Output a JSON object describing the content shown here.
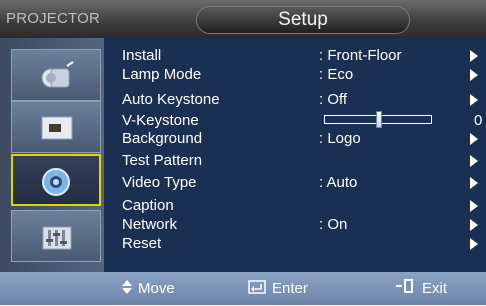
{
  "header": {
    "brand": "PROJECTOR",
    "title": "Setup"
  },
  "sidebar": {
    "items": [
      {
        "name": "picture",
        "icon": "projector-lens-icon",
        "active": false
      },
      {
        "name": "screen",
        "icon": "display-screen-icon",
        "active": false
      },
      {
        "name": "setup",
        "icon": "gear-icon",
        "active": true
      },
      {
        "name": "sound",
        "icon": "equalizer-icon",
        "active": false
      }
    ]
  },
  "menu": {
    "items": [
      {
        "label": "Install",
        "value": ": Front-Floor",
        "has_arrow": true
      },
      {
        "label": "Lamp Mode",
        "value": ": Eco",
        "has_arrow": true
      },
      {
        "label": "Auto Keystone",
        "value": ": Off",
        "has_arrow": true
      },
      {
        "label": "V-Keystone",
        "value": "",
        "has_arrow": false,
        "slider_value": "0",
        "slider_fraction": 0.5
      },
      {
        "label": "Background",
        "value": ": Logo",
        "has_arrow": true
      },
      {
        "label": "Test Pattern",
        "value": "",
        "has_arrow": true
      },
      {
        "label": "Video Type",
        "value": ": Auto",
        "has_arrow": true
      },
      {
        "label": "Caption",
        "value": "",
        "has_arrow": true
      },
      {
        "label": "Network",
        "value": ": On",
        "has_arrow": true
      },
      {
        "label": "Reset",
        "value": "",
        "has_arrow": true
      }
    ]
  },
  "footer": {
    "move": "Move",
    "enter": "Enter",
    "exit": "Exit"
  },
  "colors": {
    "list_background": "#1b2f52",
    "active_border": "#e1d400",
    "footer": "#7b94b6"
  }
}
